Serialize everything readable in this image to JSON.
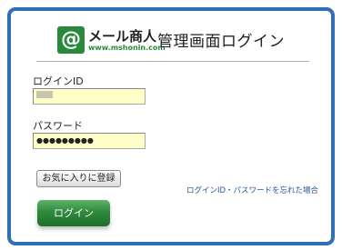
{
  "header": {
    "brand_mark": "@",
    "brand_name": "メール商人",
    "brand_url": "www.mshonin.com",
    "title": "管理画面ログイン"
  },
  "form": {
    "login_id_label": "ログインID",
    "login_id_value": "",
    "password_label": "パスワード",
    "password_value": "●●●●●●●●●"
  },
  "buttons": {
    "favorite_label": "お気に入りに登録",
    "login_label": "ログイン"
  },
  "links": {
    "forgot_label": "ログインID・パスワードを忘れた場合"
  },
  "colors": {
    "frame_border": "#2f6fb5",
    "brand_green": "#2a8a3c",
    "field_background": "#ffffc8",
    "link": "#2a5599"
  }
}
